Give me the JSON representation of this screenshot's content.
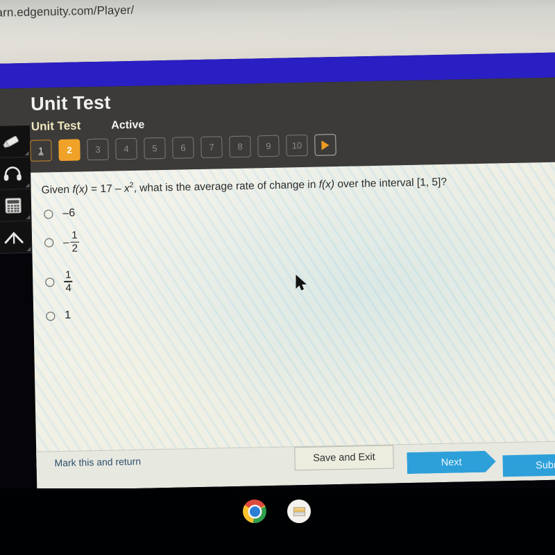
{
  "browser": {
    "url": "arn.edgenuity.com/Player/"
  },
  "header": {
    "title": "Unit Test",
    "lesson_tab": "Unit Test",
    "status_tab": "Active"
  },
  "pager": {
    "buttons": [
      {
        "label": "1",
        "state": "done"
      },
      {
        "label": "2",
        "state": "current"
      },
      {
        "label": "3",
        "state": "locked"
      },
      {
        "label": "4",
        "state": "locked"
      },
      {
        "label": "5",
        "state": "locked"
      },
      {
        "label": "6",
        "state": "locked"
      },
      {
        "label": "7",
        "state": "locked"
      },
      {
        "label": "8",
        "state": "locked"
      },
      {
        "label": "9",
        "state": "locked"
      },
      {
        "label": "10",
        "state": "locked"
      }
    ],
    "next_arrow": "next-page-arrow"
  },
  "tools": [
    {
      "name": "highlighter-icon"
    },
    {
      "name": "headphones-icon"
    },
    {
      "name": "calculator-icon"
    },
    {
      "name": "collapse-up-arrow-icon"
    }
  ],
  "question": {
    "prefix": "Given ",
    "f_of_x": "f(x)",
    "equals": " = 17 – ",
    "x_var": "x",
    "exponent": "2",
    "middle": ", what is the average rate of change in ",
    "f_of_x_2": "f(x)",
    "suffix": " over the interval [1, 5]?",
    "options": [
      {
        "label": "–6",
        "type": "plain"
      },
      {
        "label": "-1/2",
        "type": "fraction",
        "sign": "–",
        "numerator": "1",
        "denominator": "2"
      },
      {
        "label": "1/4",
        "type": "fraction",
        "sign": "",
        "numerator": "1",
        "denominator": "4"
      },
      {
        "label": "1",
        "type": "plain"
      }
    ]
  },
  "footer": {
    "mark_and_return": "Mark this and return",
    "save_and_exit": "Save and Exit",
    "next": "Next",
    "submit": "Submit"
  },
  "taskbar": {
    "items": [
      {
        "name": "chrome-icon"
      },
      {
        "name": "files-icon"
      }
    ]
  },
  "colors": {
    "banner_blue": "#2a1fc3",
    "header_dark": "#3c3b39",
    "accent_orange": "#f0a228",
    "button_blue": "#2da0da",
    "content_bg": "#edeee6",
    "link_blue": "#2d4f6b"
  }
}
